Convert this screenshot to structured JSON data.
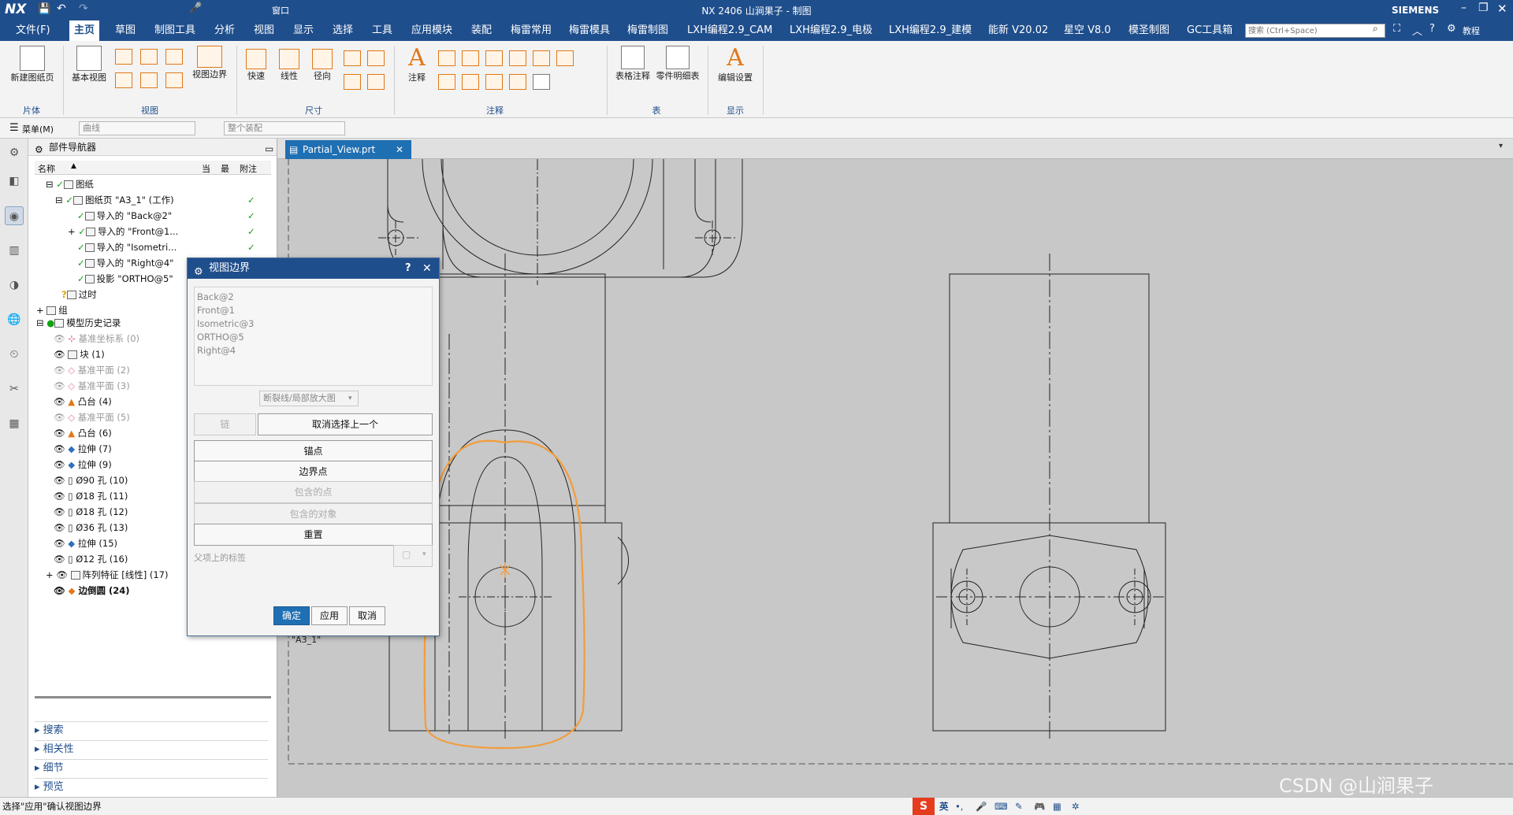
{
  "title_bar": {
    "app_logo": "NX",
    "window_title": "NX 2406 山涧果子 - 制图",
    "window_menu_label": "窗口",
    "brand": "SIEMENS"
  },
  "menu": {
    "file": "文件(F)",
    "items": [
      "主页",
      "草图",
      "制图工具",
      "分析",
      "视图",
      "显示",
      "选择",
      "工具",
      "应用模块",
      "装配",
      "梅雷常用",
      "梅雷模具",
      "梅雷制图",
      "LXH编程2.9_CAM",
      "LXH编程2.9_电极",
      "LXH编程2.9_建模",
      "能新 V20.02",
      "星空 V8.0",
      "模圣制图",
      "GC工具箱"
    ],
    "active": "主页",
    "search_placeholder": "搜索 (Ctrl+Space)",
    "tutorial": "教程"
  },
  "ribbon": {
    "new_sheet": "新建图纸页",
    "base_view": "基本视图",
    "view_boundary": "视图边界",
    "quick": "快速",
    "linear": "线性",
    "radial": "径向",
    "note": "注释",
    "table_note": "表格注释",
    "parts_list": "零件明细表",
    "edit_settings": "编辑设置",
    "groups": {
      "sheet": "片体",
      "view": "视图",
      "dimension": "尺寸",
      "annotation": "注释",
      "table": "表",
      "display": "显示"
    }
  },
  "selection_bar": {
    "menu": "菜单(M)",
    "filter": "曲线",
    "scope": "整个装配"
  },
  "navigator": {
    "title": "部件导航器",
    "columns": {
      "name": "名称",
      "current": "当",
      "latest": "最",
      "note": "附注"
    },
    "items": [
      {
        "label": "图纸",
        "check": ""
      },
      {
        "label": "图纸页 \"A3_1\" (工作)",
        "check": "✓"
      },
      {
        "label": "导入的 \"Back@2\"",
        "check": "✓"
      },
      {
        "label": "导入的 \"Front@1...",
        "check": "✓"
      },
      {
        "label": "导入的 \"Isometri...",
        "check": "✓"
      },
      {
        "label": "导入的 \"Right@4\"",
        "check": "✓"
      },
      {
        "label": "投影 \"ORTHO@5\"",
        "check": "✓"
      },
      {
        "label": "过时",
        "check": ""
      },
      {
        "label": "组",
        "check": ""
      },
      {
        "label": "模型历史记录",
        "check": ""
      },
      {
        "label": "基准坐标系 (0)",
        "check": ""
      },
      {
        "label": "块 (1)",
        "check": ""
      },
      {
        "label": "基准平面 (2)",
        "check": ""
      },
      {
        "label": "基准平面 (3)",
        "check": ""
      },
      {
        "label": "凸台 (4)",
        "check": ""
      },
      {
        "label": "基准平面 (5)",
        "check": ""
      },
      {
        "label": "凸台 (6)",
        "check": ""
      },
      {
        "label": "拉伸 (7)",
        "check": ""
      },
      {
        "label": "拉伸 (9)",
        "check": ""
      },
      {
        "label": "Ø90 孔 (10)",
        "check": ""
      },
      {
        "label": "Ø18 孔 (11)",
        "check": ""
      },
      {
        "label": "Ø18 孔 (12)",
        "check": ""
      },
      {
        "label": "Ø36 孔 (13)",
        "check": ""
      },
      {
        "label": "拉伸 (15)",
        "check": ""
      },
      {
        "label": "Ø12 孔 (16)",
        "check": ""
      },
      {
        "label": "阵列特征 [线性] (17)",
        "check": ""
      },
      {
        "label": "边倒圆 (24)",
        "check": ""
      }
    ],
    "accordion": [
      "搜索",
      "相关性",
      "细节",
      "预览"
    ]
  },
  "canvas": {
    "tab": "Partial_View.prt",
    "sheet_label": "\"A3_1\""
  },
  "dialog": {
    "title": "视图边界",
    "help": "?",
    "views": [
      "Back@2",
      "Front@1",
      "Isometric@3",
      "ORTHO@5",
      "Right@4"
    ],
    "boundary_type": "断裂线/局部放大图",
    "chain": "链",
    "deselect": "取消选择上一个",
    "anchor": "锚点",
    "boundary_point": "边界点",
    "included_point": "包含的点",
    "included_object": "包含的对象",
    "reset": "重置",
    "parent_label": "父项上的标签",
    "ok": "确定",
    "apply": "应用",
    "cancel": "取消"
  },
  "status": {
    "text": "选择\"应用\"确认视图边界",
    "ime": "英",
    "watermark": "CSDN @山涧果子"
  }
}
